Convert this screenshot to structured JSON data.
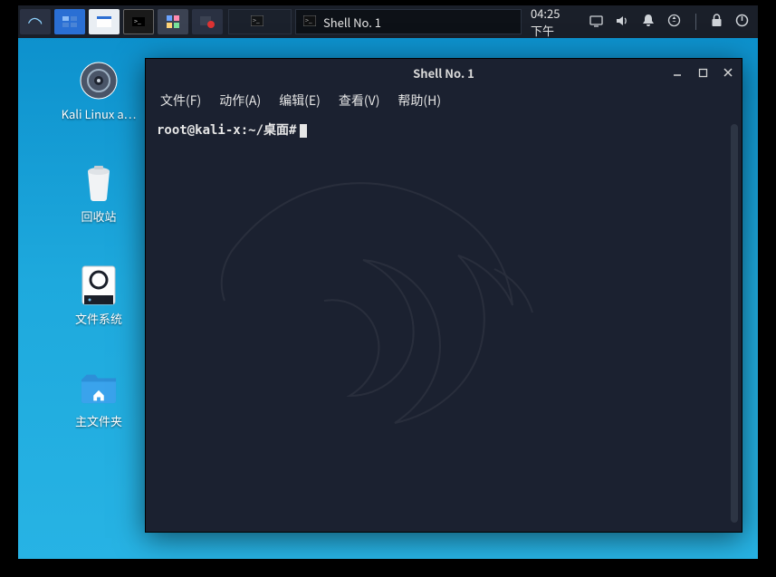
{
  "panel": {
    "launchers": [
      {
        "name": "kali-menu",
        "label": "Kali"
      },
      {
        "name": "workspace-switcher",
        "label": ""
      },
      {
        "name": "file-manager",
        "label": ""
      },
      {
        "name": "terminal-quick",
        "label": ""
      },
      {
        "name": "app-grid",
        "label": ""
      },
      {
        "name": "record-screen",
        "label": ""
      }
    ],
    "tasks": [
      {
        "label": "",
        "active": false,
        "iconOnly": true
      },
      {
        "label": "Shell No. 1",
        "active": true
      }
    ],
    "clock": "04:25 下午"
  },
  "tray_icons": [
    "display-icon",
    "volume-icon",
    "bell-icon",
    "power-arrow-icon",
    "lock-icon",
    "logout-icon"
  ],
  "desktop_icons": [
    {
      "name": "kali-iso-icon",
      "label": "Kali Linux a…",
      "glyph": "disc"
    },
    {
      "name": "trash-icon",
      "label": "回收站",
      "glyph": "trash"
    },
    {
      "name": "filesystem-icon",
      "label": "文件系统",
      "glyph": "drive"
    },
    {
      "name": "home-icon",
      "label": "主文件夹",
      "glyph": "home"
    }
  ],
  "window": {
    "title": "Shell No. 1",
    "menubar": [
      {
        "label": "文件(F)"
      },
      {
        "label": "动作(A)"
      },
      {
        "label": "编辑(E)"
      },
      {
        "label": "查看(V)"
      },
      {
        "label": "帮助(H)"
      }
    ],
    "terminal": {
      "prompt": "root@kali-x:~/桌面#"
    }
  }
}
